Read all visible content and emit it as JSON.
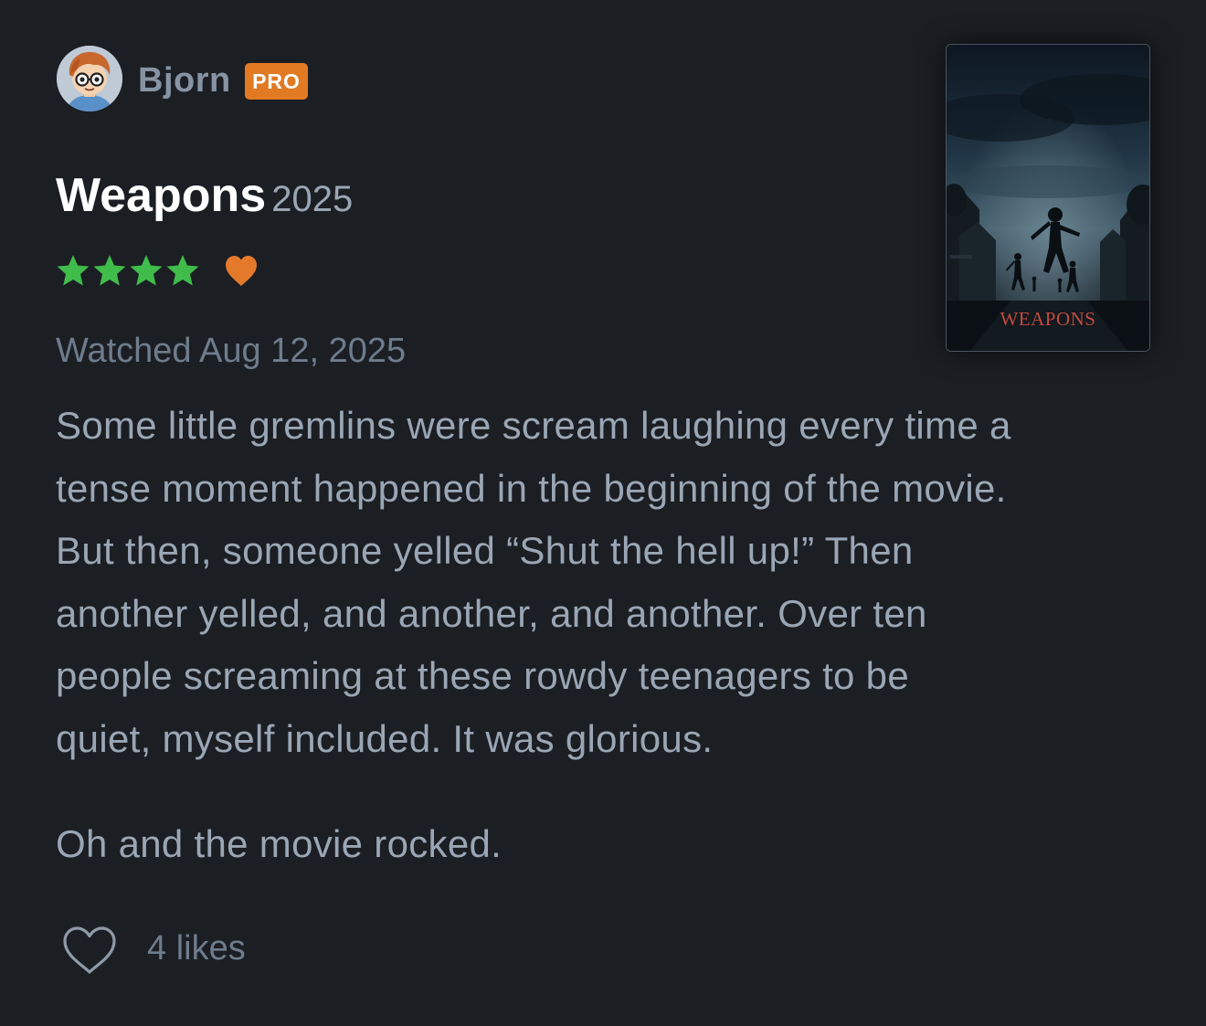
{
  "colors": {
    "background": "#1b1e23",
    "star_green": "#40bc4b",
    "heart_orange": "#e5792b",
    "pro_badge": "#e17a22",
    "text_primary": "#ffffff",
    "text_muted": "#9aa6b4"
  },
  "user": {
    "name": "Bjorn",
    "badge": "PRO",
    "avatar_icon": "cartoon-avatar"
  },
  "film": {
    "title": "Weapons",
    "year": "2025",
    "poster_title": "WEAPONS"
  },
  "rating": {
    "stars": 4,
    "max_stars": 5,
    "liked": true
  },
  "watched": "Watched Aug 12, 2025",
  "review": {
    "paragraph1_lines": [
      "Some little gremlins were scream laughing every time a",
      "tense moment happened in the beginning of the movie.",
      "But then, someone yelled “Shut the hell up!” Then",
      "another yelled, and another, and another. Over ten",
      "people screaming at these rowdy teenagers to be",
      "quiet, myself included. It was glorious."
    ],
    "paragraph2": "Oh and the movie rocked."
  },
  "likes": {
    "icon": "heart-outline-icon",
    "label": "4 likes"
  }
}
